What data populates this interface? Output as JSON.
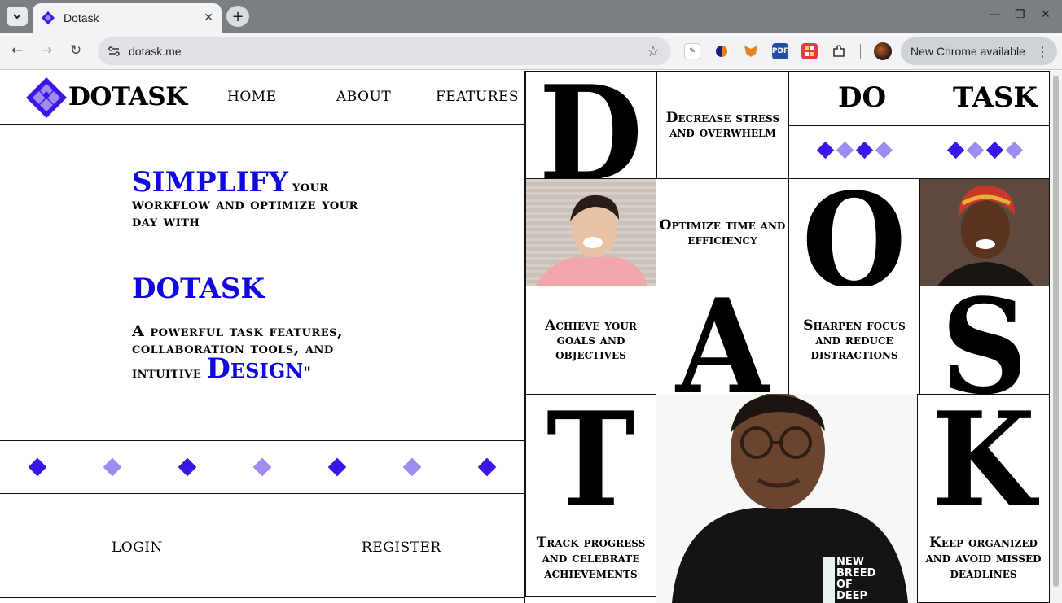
{
  "browser": {
    "tab_title": "Dotask",
    "url": "dotask.me",
    "update_label": "New Chrome available",
    "pdf_ext_label": "PDF"
  },
  "nav": {
    "logo": "DOTASK",
    "links": [
      "HOME",
      "ABOUT",
      "FEATURES"
    ]
  },
  "hero": {
    "simplify": "SIMPLIFY",
    "line1_tail": "your",
    "line2": "workflow and optimize your",
    "line3": "day with",
    "brand": "DOTASK",
    "desc1": "A powerful task features,",
    "desc2": "collaboration tools, and",
    "desc3": "intuitive",
    "design": "Design",
    "design_quote": "\""
  },
  "auth": {
    "login": "LOGIN",
    "register": "REGISTER"
  },
  "grid": {
    "letters": [
      "D",
      "O",
      "A",
      "S",
      "T",
      "K"
    ],
    "words": [
      "DO",
      "TASK"
    ],
    "benefits": [
      "Decrease stress and overwhelm",
      "Optimize time and efficiency",
      "Achieve your goals and objectives",
      "Sharpen focus and reduce distractions",
      "Track progress and celebrate achievements",
      "Keep organized and avoid missed deadlines"
    ],
    "shirt_text": "NEW BREED OF DEEP"
  },
  "colors": {
    "accent": "#1008e0",
    "diamond_dark": "#3b16e6",
    "diamond_light": "#a08cf0"
  },
  "icons": {
    "logo": "diamond-cluster-icon",
    "band": "diamond-icon",
    "star": "star-icon"
  }
}
